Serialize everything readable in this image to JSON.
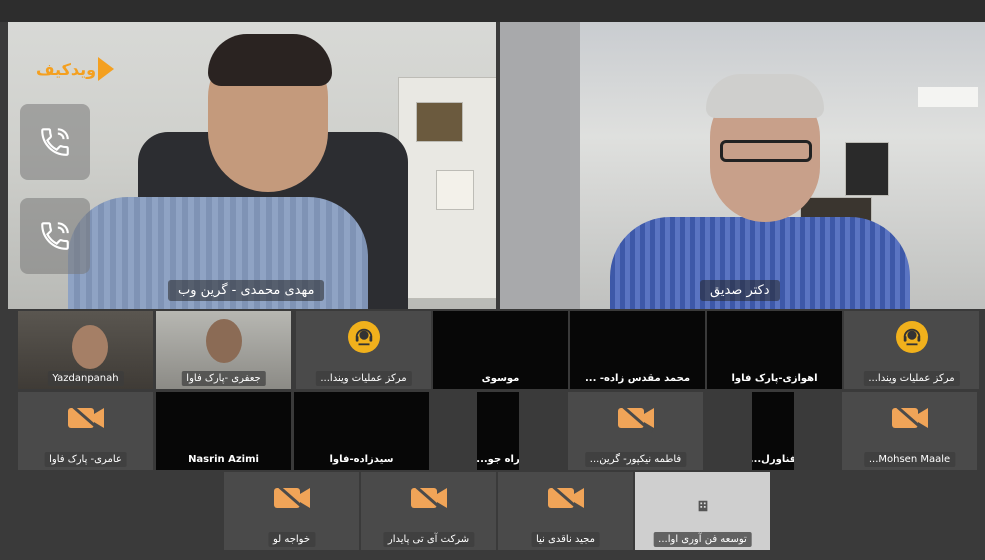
{
  "main_speakers": [
    {
      "name": "مهدی محمدی - گرین وب"
    },
    {
      "name": "دکتر صدیق"
    }
  ],
  "logo": {
    "text": "ویدکیف"
  },
  "call_buttons": [
    {
      "icon": "phone-icon"
    },
    {
      "icon": "phone-icon"
    }
  ],
  "participants_row1": [
    {
      "name": "Yazdanpanah",
      "type": "video"
    },
    {
      "name": "جعفری -پارک فاوا",
      "type": "video"
    },
    {
      "name": "مرکز عملیات ویندا...",
      "type": "avatar",
      "icon": "headset-icon"
    },
    {
      "name": "موسوی",
      "type": "black"
    },
    {
      "name": "محمد مقدس زاده- ...",
      "type": "black"
    },
    {
      "name": "اهوازی-پارک فاوا",
      "type": "black"
    },
    {
      "name": "مرکز عملیات ویندا...",
      "type": "avatar",
      "icon": "headset-icon"
    }
  ],
  "participants_row2": [
    {
      "name": "عامری- پارک فاوا",
      "type": "camera-off"
    },
    {
      "name": "Nasrin Azimi",
      "type": "black"
    },
    {
      "name": "سیدزاده-فاوا",
      "type": "black"
    },
    {
      "name": "راه جو...",
      "type": "black-narrow"
    },
    {
      "name": "فاطمه نیکپور- گرین...",
      "type": "camera-off"
    },
    {
      "name": "فناورل...",
      "type": "black-narrow"
    },
    {
      "name": "Mohsen Maale...",
      "type": "camera-off"
    }
  ],
  "participants_row3": [
    {
      "name": "خواجه لو",
      "type": "camera-off"
    },
    {
      "name": "شرکت آی تی پایدار",
      "type": "camera-off"
    },
    {
      "name": "مجید ناقدی نیا",
      "type": "camera-off"
    },
    {
      "name": "توسعه فن آوری اوا...",
      "type": "light"
    }
  ],
  "colors": {
    "accent": "#f4a020",
    "camera_off": "#f0a458",
    "avatar": "#f1b11c"
  }
}
